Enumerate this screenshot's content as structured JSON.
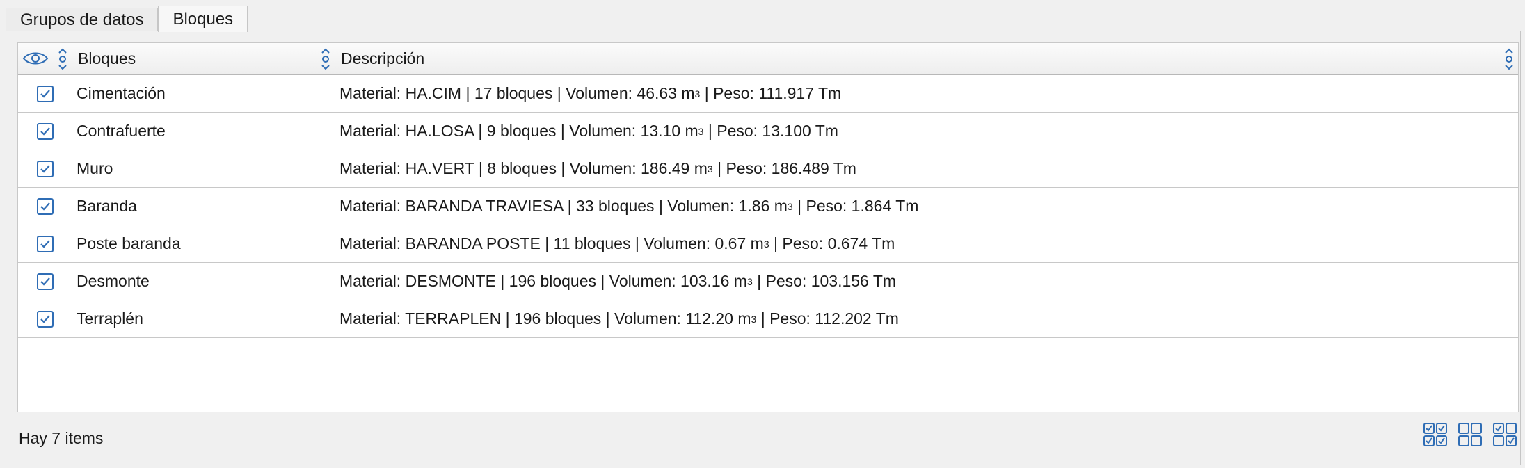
{
  "tabs": [
    {
      "label": "Grupos de datos",
      "active": false
    },
    {
      "label": "Bloques",
      "active": true
    }
  ],
  "table": {
    "columns": {
      "visibility_icon": "eye-icon",
      "name": "Bloques",
      "description": "Descripción"
    },
    "rows": [
      {
        "checked": true,
        "name": "Cimentación",
        "desc_pre": "Material: HA.CIM | 17 bloques | Volumen: 46.63 m",
        "desc_sup": "3",
        "desc_post": " | Peso: 111.917 Tm"
      },
      {
        "checked": true,
        "name": "Contrafuerte",
        "desc_pre": "Material: HA.LOSA | 9 bloques | Volumen: 13.10 m",
        "desc_sup": "3",
        "desc_post": " | Peso: 13.100 Tm"
      },
      {
        "checked": true,
        "name": "Muro",
        "desc_pre": "Material: HA.VERT | 8 bloques | Volumen: 186.49 m",
        "desc_sup": "3",
        "desc_post": " | Peso: 186.489 Tm"
      },
      {
        "checked": true,
        "name": "Baranda",
        "desc_pre": "Material: BARANDA TRAVIESA | 33 bloques | Volumen: 1.86 m",
        "desc_sup": "3",
        "desc_post": " | Peso: 1.864 Tm"
      },
      {
        "checked": true,
        "name": "Poste baranda",
        "desc_pre": "Material: BARANDA POSTE | 11 bloques | Volumen: 0.67 m",
        "desc_sup": "3",
        "desc_post": " | Peso: 0.674 Tm"
      },
      {
        "checked": true,
        "name": "Desmonte",
        "desc_pre": "Material: DESMONTE | 196 bloques | Volumen: 103.16 m",
        "desc_sup": "3",
        "desc_post": " | Peso: 103.156 Tm"
      },
      {
        "checked": true,
        "name": "Terraplén",
        "desc_pre": "Material: TERRAPLEN | 196 bloques | Volumen: 112.20 m",
        "desc_sup": "3",
        "desc_post": " | Peso: 112.202 Tm"
      }
    ]
  },
  "status": {
    "text": "Hay 7 items"
  },
  "footer_icons": [
    "check-all-icon",
    "uncheck-all-icon",
    "invert-check-icon"
  ],
  "colors": {
    "accent": "#2f6db5"
  }
}
